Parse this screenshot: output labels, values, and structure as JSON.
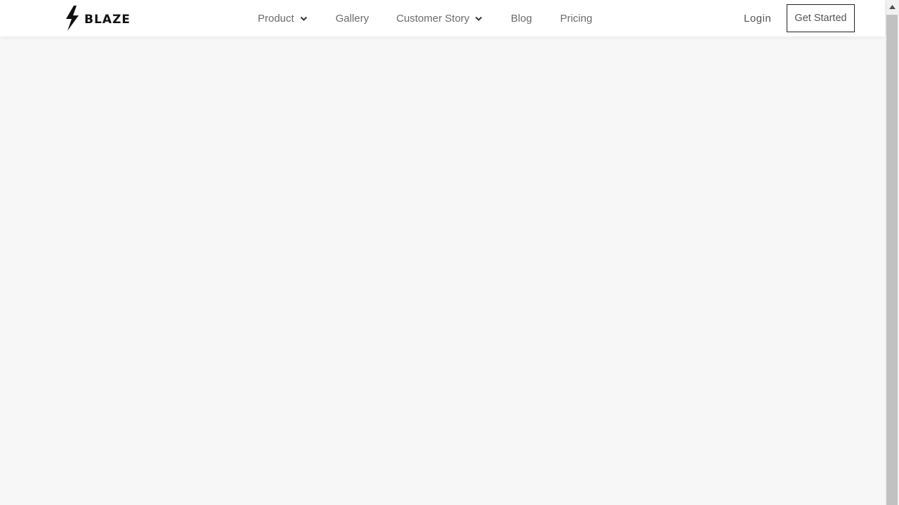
{
  "brand": {
    "name": "BLAZE",
    "icon": "lightning-bolt-icon"
  },
  "nav": {
    "items": [
      {
        "label": "Product",
        "has_dropdown": true,
        "icon": "chevron-down-icon"
      },
      {
        "label": "Gallery",
        "has_dropdown": false
      },
      {
        "label": "Customer Story",
        "has_dropdown": true,
        "icon": "chevron-down-icon"
      },
      {
        "label": "Blog",
        "has_dropdown": false
      },
      {
        "label": "Pricing",
        "has_dropdown": false
      }
    ]
  },
  "actions": {
    "login_label": "Login",
    "get_started_label": "Get Started"
  },
  "scrollbar": {
    "up_icon": "scroll-up-arrow-icon"
  },
  "colors": {
    "header_bg": "#ffffff",
    "page_bg": "#f7f7f7",
    "nav_text": "#6b6b6b",
    "brand_text": "#111111",
    "button_border": "#222222",
    "scroll_thumb": "#c1c1c1"
  }
}
